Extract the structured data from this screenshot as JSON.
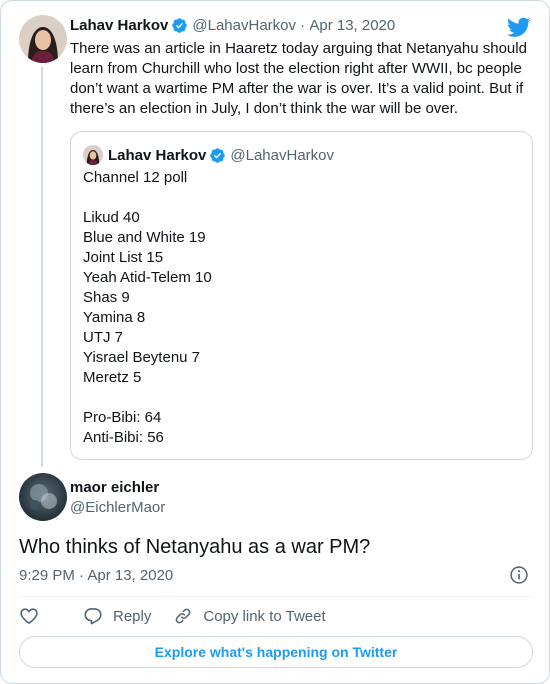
{
  "parent_tweet": {
    "author_name": "Lahav Harkov",
    "author_handle": "@LahavHarkov",
    "separator": "·",
    "date": "Apr 13, 2020",
    "text": "There was an article in Haaretz today arguing that Netanyahu should learn from Churchill who lost the election right after WWII, bc people don’t want a wartime PM after the war is over. It’s a valid point. But if there’s an election in July, I don’t think the war will be over."
  },
  "quoted_tweet": {
    "author_name": "Lahav Harkov",
    "author_handle": "@LahavHarkov",
    "lines": [
      "Channel 12 poll",
      "",
      "Likud 40",
      "Blue and White 19",
      "Joint List 15",
      "Yeah Atid-Telem 10",
      "Shas 9",
      "Yamina 8",
      "UTJ 7",
      "Yisrael Beytenu 7",
      "Meretz 5",
      "",
      "Pro-Bibi: 64",
      "Anti-Bibi: 56"
    ]
  },
  "reply_tweet": {
    "author_name": "maor eichler",
    "author_handle": "@EichlerMaor",
    "text": "Who thinks of Netanyahu as a war PM?",
    "timestamp": "9:29 PM · Apr 13, 2020"
  },
  "actions": {
    "reply_label": "Reply",
    "copy_link_label": "Copy link to Tweet"
  },
  "explore_label": "Explore what's happening on Twitter",
  "icons": {
    "verified": "verified-badge-icon",
    "brand": "twitter-bird-icon",
    "info": "info-icon",
    "like": "heart-icon",
    "reply": "reply-bubble-icon",
    "link": "link-icon"
  },
  "colors": {
    "brand_blue": "#1d9bf0",
    "text_primary": "#0f1419",
    "text_secondary": "#536471",
    "border": "#cfd9de"
  }
}
